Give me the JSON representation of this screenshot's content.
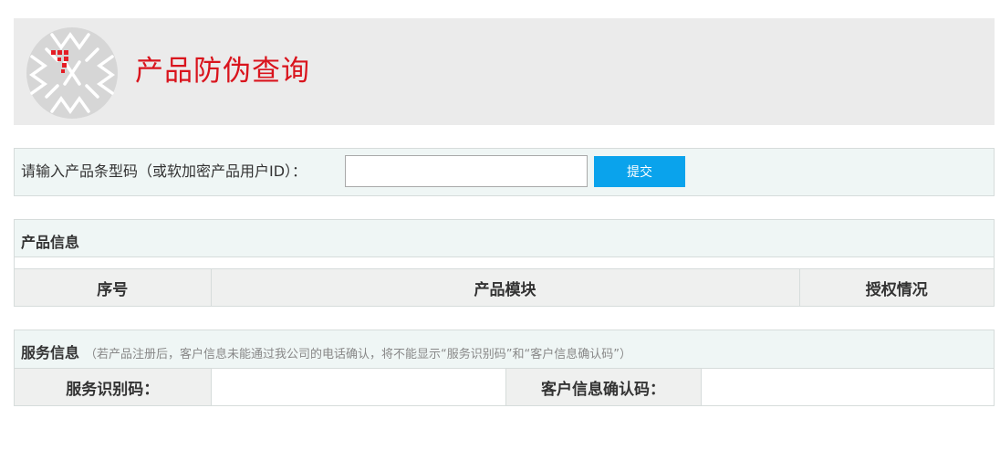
{
  "header": {
    "logo_icon": "emblem-logo-icon",
    "title": "产品防伪查询",
    "title_color": "#d9141d"
  },
  "query": {
    "label": "请输入产品条型码（或软加密产品用户ID）：",
    "input_value": "",
    "submit_label": "提交",
    "button_color": "#0aa3ec"
  },
  "product_info": {
    "title": "产品信息",
    "columns": [
      "序号",
      "产品模块",
      "授权情况"
    ]
  },
  "service_info": {
    "title": "服务信息",
    "note": "（若产品注册后，客户信息未能通过我公司的电话确认，将不能显示“服务识别码”和“客户信息确认码”）",
    "service_code_label": "服务识别码：",
    "service_code_value": "",
    "confirm_code_label": "客户信息确认码：",
    "confirm_code_value": ""
  }
}
